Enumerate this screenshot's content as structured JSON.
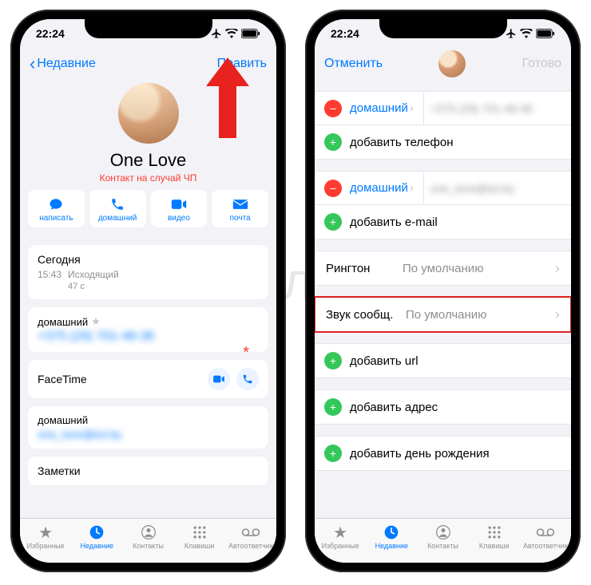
{
  "watermark": "Яблык",
  "status": {
    "time": "22:24"
  },
  "left": {
    "nav": {
      "back": "Недавние",
      "edit": "Править"
    },
    "contact": {
      "name": "One Love",
      "emergency": "Контакт на случай ЧП"
    },
    "actions": {
      "message": "написать",
      "call": "домашний",
      "video": "видео",
      "mail": "почта"
    },
    "calllog": {
      "day": "Сегодня",
      "time": "15:43",
      "type": "Исходящий",
      "duration": "47 с"
    },
    "phone": {
      "label": "домашний",
      "value": "+375 (29) 701-48-36"
    },
    "facetime": "FaceTime",
    "email": {
      "label": "домашний",
      "value": "one_love@tut.by"
    },
    "notes": "Заметки"
  },
  "right": {
    "nav": {
      "cancel": "Отменить",
      "done": "Готово"
    },
    "phone_section": {
      "label": "домашний",
      "value": "+375 (29) 701-48-36",
      "add": "добавить телефон"
    },
    "email_section": {
      "label": "домашний",
      "value": "one_love@tut.by",
      "add": "добавить e-mail"
    },
    "ringtone": {
      "key": "Рингтон",
      "value": "По умолчанию"
    },
    "texttone": {
      "key": "Звук сообщ.",
      "value": "По умолчанию"
    },
    "add_url": "добавить url",
    "add_address": "добавить адрес",
    "add_birthday": "добавить день рождения"
  },
  "tabs": {
    "favorites": "Избранные",
    "recents": "Недавние",
    "contacts": "Контакты",
    "keypad": "Клавиши",
    "voicemail": "Автоответчик"
  }
}
